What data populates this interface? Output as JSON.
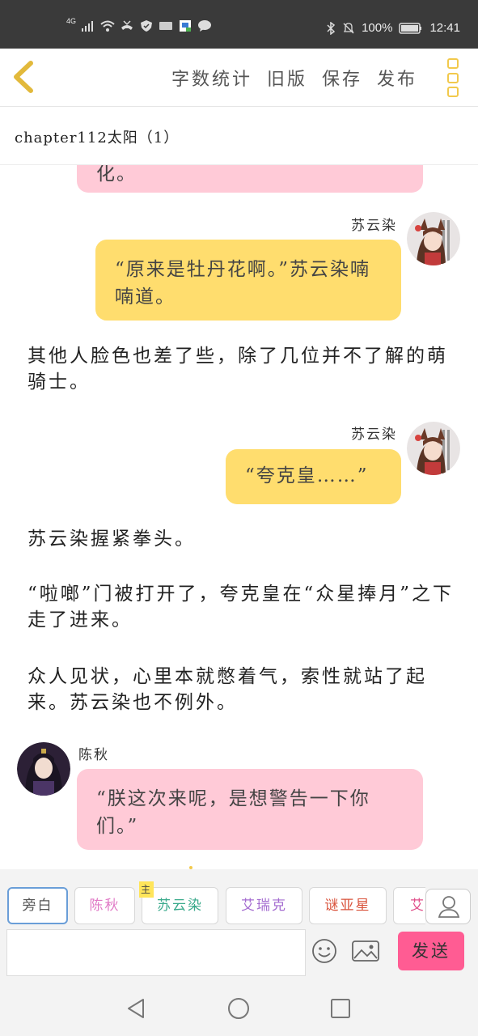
{
  "status_bar": {
    "network": "4G",
    "battery": "100%",
    "time": "12:41"
  },
  "toolbar": {
    "word_count": "字数统计",
    "old_version": "旧版",
    "save": "保存",
    "publish": "发布"
  },
  "chapter": {
    "title": "chapter112太阳（1）"
  },
  "messages": [
    {
      "type": "bubble",
      "speaker": "",
      "color": "#ffcad7",
      "text": "化。"
    },
    {
      "type": "bubble",
      "speaker": "苏云染",
      "color": "#ffdd6e",
      "text": "“原来是牡丹花啊。”苏云染喃喃道。"
    },
    {
      "type": "narration",
      "text": "其他人脸色也差了些，除了几位并不了解的萌骑士。"
    },
    {
      "type": "bubble",
      "speaker": "苏云染",
      "color": "#ffdd6e",
      "text": "“夸克皇……”"
    },
    {
      "type": "narration",
      "text": "苏云染握紧拳头。"
    },
    {
      "type": "narration",
      "text": "“啦啷”门被打开了，夸克皇在“众星捧月”之下走了进来。"
    },
    {
      "type": "narration",
      "text": "众人见状，心里本就憋着气，索性就站了起来。苏云染也不例外。"
    },
    {
      "type": "bubble",
      "speaker": "陈秋",
      "color": "#ffcad7",
      "text": "“朕这次来呢，是想警告一下你们。”"
    }
  ],
  "characters": [
    {
      "label": "旁白",
      "color": "#555555"
    },
    {
      "label": "陈秋",
      "color": "#e07ac6"
    },
    {
      "label": "苏云染",
      "color": "#3aaa8c",
      "tag": "主"
    },
    {
      "label": "艾瑞克",
      "color": "#a46cd0"
    },
    {
      "label": "谜亚星",
      "color": "#d9533c"
    },
    {
      "label": "艾",
      "color": "#e04f8a"
    }
  ],
  "input": {
    "placeholder": "",
    "send_label": "发送"
  },
  "icons": {
    "back": "chevron-left-icon",
    "menu": "more-vertical-icon",
    "emoji": "emoji-icon",
    "image": "image-icon",
    "person": "person-icon"
  },
  "colors": {
    "accent": "#f2c94c",
    "send": "#ff5c93",
    "pink_bubble": "#ffcad7",
    "yellow_bubble": "#ffdd6e"
  }
}
